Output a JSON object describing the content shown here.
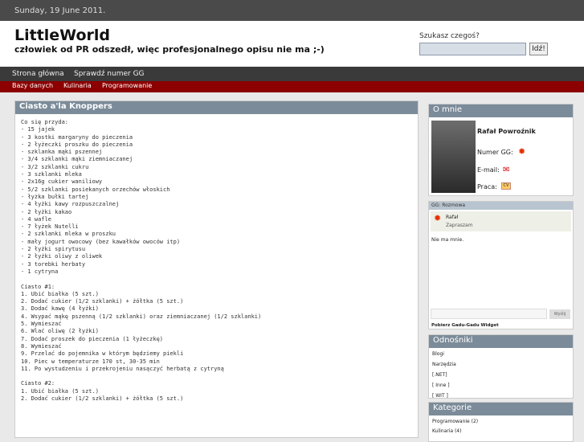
{
  "date": "Sunday, 19 June 2011.",
  "site": {
    "title": "LittleWorld",
    "subtitle": "człowiek od PR odszedł, więc profesjonalnego opisu nie ma ;-)"
  },
  "search": {
    "label": "Szukasz czegoś?",
    "button": "Idź!"
  },
  "nav": [
    "Strona główna",
    "Sprawdź numer GG"
  ],
  "subnav": [
    "Bazy danych",
    "Kulinaria",
    "Programowanie"
  ],
  "post": {
    "title": "Ciasto a'la Knoppers",
    "body": "Co się przyda:\n- 15 jajek\n- 3 kostki margaryny do pieczenia\n- 2 łyżeczki proszku do pieczenia\n- szklanka mąki pszennej\n- 3/4 szklanki mąki ziemniaczanej\n- 3/2 szklanki cukru\n- 3 szklanki mleka\n- 2x16g cukier waniliowy\n- 5/2 szklanki posiekanych orzechów włoskich\n- łyżka bułki tartej\n- 4 łyżki kawy rozpuszczalnej\n- 2 łyżki kakao\n- 4 wafle\n- 7 łyżek Nutelli\n- 2 szklanki mleka w proszku\n- mały jogurt owocowy (bez kawałków owoców itp)\n- 2 łyżki spirytusu\n- 2 łyżki oliwy z oliwek\n- 3 torebki herbaty\n- 1 cytryna\n\nCiasto #1:\n1. Ubić białka (5 szt.)\n2. Dodać cukier (1/2 szklanki) + żółtka (5 szt.)\n3. Dodać kawę (4 łyżki)\n4. Wsypać mąkę pszenną (1/2 szklanki) oraz ziemniaczanej (1/2 szklanki)\n5. Wymieszać\n6. Wlać oliwę (2 łyżki)\n7. Dodać proszek do pieczenia (1 łyżeczkę)\n8. Wymieszać\n9. Przelać do pojemnika w którym będziemy piekli\n10. Piec w temperaturze 170 st, 30-35 min\n11. Po wystudzeniu i przekrojeniu nasączyć herbatą z cytryną\n\nCiasto #2:\n1. Ubić białka (5 szt.)\n2. Dodać cukier (1/2 szklanki) + żółtka (5 szt.)"
  },
  "about": {
    "title": "O mnie",
    "name": "Rafał Powroźnik",
    "gg": "Numer GG:",
    "email": "E-mail:",
    "work": "Praca:"
  },
  "gg_widget": {
    "title": "GG: Rozmowa",
    "contact": "Rafał",
    "status": "Zapraszam",
    "message": "Nie ma mnie.",
    "send": "Wyślij",
    "footer": "Pobierz Gadu-Gadu Widget"
  },
  "links": {
    "title": "Odnośniki",
    "items": [
      "Blogi",
      "Narzędzia",
      "[.NET]",
      "[ Inne ]",
      "[ WIT ]"
    ]
  },
  "categories": {
    "title": "Kategorie",
    "items": [
      "Programowanie (2)",
      "Kulinaria (4)"
    ]
  }
}
